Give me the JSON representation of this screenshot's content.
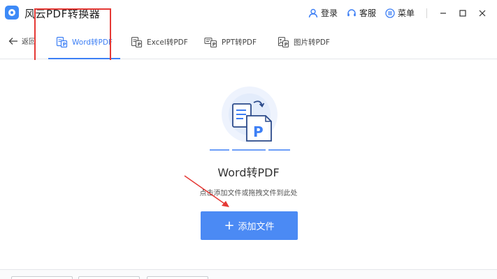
{
  "app": {
    "title": "风云PDF转换器"
  },
  "header": {
    "login": "登录",
    "service": "客服",
    "menu": "菜单"
  },
  "nav": {
    "back": "返回",
    "tabs": [
      {
        "label": "Word转PDF",
        "active": true
      },
      {
        "label": "Excel转PDF",
        "active": false
      },
      {
        "label": "PPT转PDF",
        "active": false
      },
      {
        "label": "图片转PDF",
        "active": false
      }
    ]
  },
  "main": {
    "title": "Word转PDF",
    "hint": "点击添加文件或拖拽文件到此处",
    "add_button": "添加文件"
  },
  "colors": {
    "accent": "#3d7ff5",
    "button": "#4b8af4",
    "highlight": "#e53935",
    "annotation_arrow": "#e53935"
  },
  "icons": [
    "app-logo",
    "user-icon",
    "headset-icon",
    "menu-icon",
    "minimize-icon",
    "maximize-icon",
    "close-icon",
    "back-arrow-icon",
    "word-file-icon",
    "excel-file-icon",
    "ppt-file-icon",
    "image-file-icon",
    "word-to-pdf-illustration",
    "plus-icon"
  ]
}
